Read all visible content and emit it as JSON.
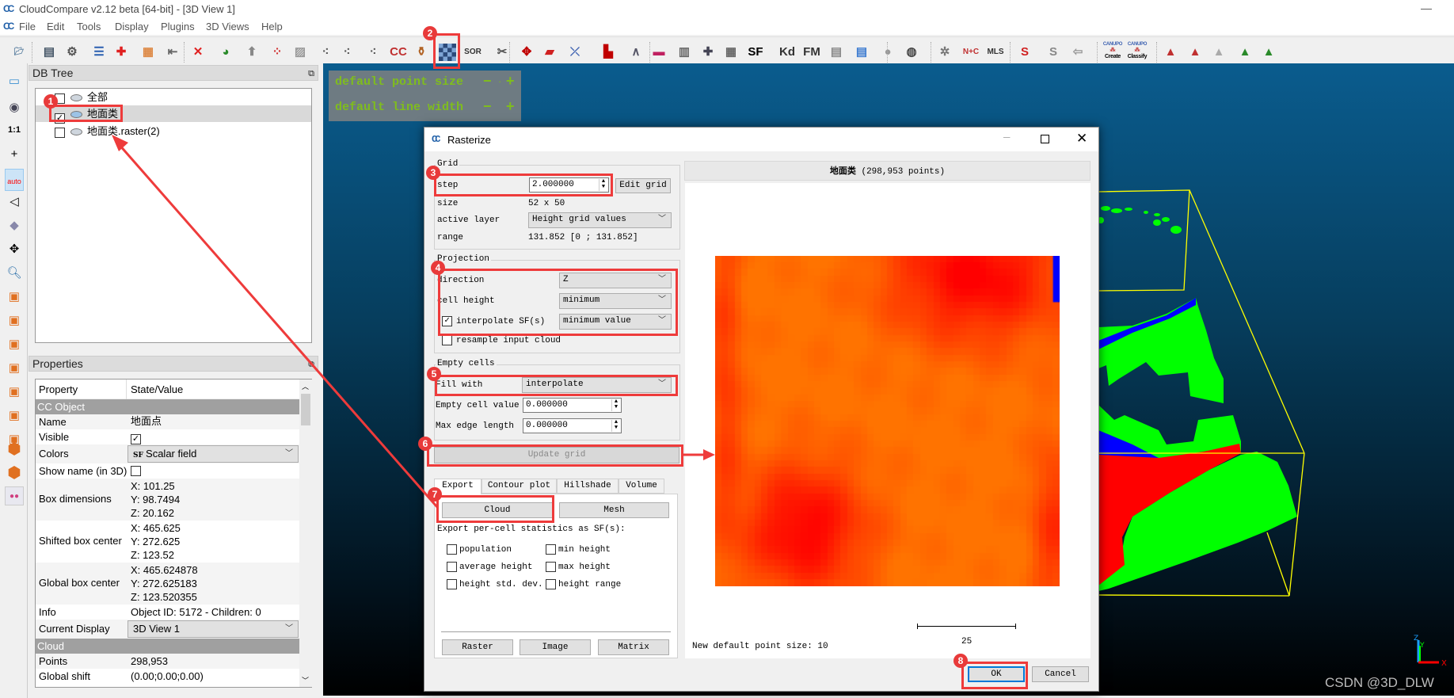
{
  "app": {
    "title": "CloudCompare v2.12 beta [64-bit] - [3D View 1]",
    "logo": "CC"
  },
  "menu": [
    "File",
    "Edit",
    "Tools",
    "Display",
    "Plugins",
    "3D Views",
    "Help"
  ],
  "toolbar": {
    "icons": [
      "open-icon",
      "save-icon",
      "settings-icon",
      "list-icon",
      "clone-icon",
      "color-icon",
      "detach-icon",
      "delete-icon",
      "segment-icon",
      "bust-icon",
      "sample-icon",
      "mesh-icon",
      "points-icon",
      "points2-icon",
      "points3-icon",
      "cc-icon",
      "bottle-icon",
      "rasterize-icon",
      "sor-icon",
      "scissors-icon",
      "translate-icon",
      "plane-icon",
      "cross-icon",
      "histogram-icon",
      "stats-icon",
      "minmax-icon",
      "trash-icon",
      "plus-icon",
      "calculator-icon",
      "sf-icon",
      "kd-icon",
      "fm-icon",
      "shp-icon",
      "csv-icon",
      "sphere-icon",
      "globe-icon",
      "puzzle-icon",
      "normals-icon",
      "mls-icon",
      "curve-icon",
      "trace-icon",
      "export-icon",
      "canupo-create-icon",
      "canupo-classify-icon",
      "rgb-icon",
      "hsv-icon",
      "gray-icon",
      "h-icon",
      "k-icon"
    ],
    "labels": {
      "sor": "SOR",
      "sf": "SF",
      "kd": "Kd",
      "fm": "FM",
      "nc": "N+C",
      "mls": "MLS",
      "canupo": "CANUPO",
      "create": "Create",
      "classify": "Classify"
    }
  },
  "dbtree": {
    "title": "DB Tree",
    "items": [
      {
        "label": "全部",
        "checked": false
      },
      {
        "label": "地面类",
        "checked": true,
        "selected": true
      },
      {
        "label": "地面类.raster(2)",
        "checked": false
      }
    ]
  },
  "properties": {
    "title": "Properties",
    "col_property": "Property",
    "col_value": "State/Value",
    "section_cc": "CC Object",
    "section_cloud": "Cloud",
    "name_k": "Name",
    "name_v": "地面点",
    "visible_k": "Visible",
    "colors_k": "Colors",
    "colors_v": "Scalar field",
    "showname_k": "Show name (in 3D)",
    "box_k": "Box dimensions",
    "box_v": [
      "X: 101.25",
      "Y: 98.7494",
      "Z: 20.162"
    ],
    "shifted_k": "Shifted box center",
    "shifted_v": [
      "X: 465.625",
      "Y: 272.625",
      "Z: 123.52"
    ],
    "global_k": "Global box center",
    "global_v": [
      "X: 465.624878",
      "Y: 272.625183",
      "Z: 123.520355"
    ],
    "info_k": "Info",
    "info_v": "Object ID: 5172 - Children: 0",
    "display_k": "Current Display",
    "display_v": "3D View 1",
    "points_k": "Points",
    "points_v": "298,953",
    "shift_k": "Global shift",
    "shift_v": "(0.00;0.00;0.00)"
  },
  "view3d": {
    "point_size_label": "default point size",
    "line_width_label": "default line width",
    "watermark": "CSDN @3D_DLW",
    "axes": [
      "Z",
      "Y",
      "X"
    ]
  },
  "dialog": {
    "title": "Rasterize",
    "grid": {
      "title": "Grid",
      "step_label": "step",
      "step_value": "2.000000",
      "edit_grid": "Edit grid",
      "size_label": "size",
      "size_value": "52 x 50",
      "layer_label": "active layer",
      "layer_value": "Height grid values",
      "range_label": "range",
      "range_value": "131.852 [0 ; 131.852]"
    },
    "projection": {
      "title": "Projection",
      "direction_label": "direction",
      "direction_value": "Z",
      "cell_label": "cell height",
      "cell_value": "minimum",
      "interp_label": "interpolate SF(s)",
      "interp_checked": true,
      "interp_value": "minimum value",
      "resample_label": "resample input cloud",
      "resample_checked": false
    },
    "empty": {
      "title": "Empty cells",
      "fill_label": "Fill with",
      "fill_value": "interpolate",
      "value_label": "Empty cell value",
      "value_value": "0.000000",
      "edge_label": "Max edge length",
      "edge_value": "0.000000"
    },
    "update_grid": "Update grid",
    "tabs": [
      "Export",
      "Contour plot",
      "Hillshade",
      "Volume"
    ],
    "export": {
      "cloud": "Cloud",
      "mesh": "Mesh",
      "stats_label": "Export per-cell statistics as SF(s):",
      "stats": [
        "population",
        "min height",
        "average height",
        "max height",
        "height std. dev.",
        "height range"
      ],
      "raster": "Raster",
      "image": "Image",
      "matrix": "Matrix"
    },
    "preview": {
      "header_name": "地面类",
      "header_count": "(298,953 points)",
      "scale_value": "25",
      "point_size_msg": "New default point size: 10",
      "grid_cols": 52,
      "grid_rows": 50
    },
    "ok": "OK",
    "cancel": "Cancel"
  },
  "annotations": [
    "1",
    "2",
    "3",
    "4",
    "5",
    "6",
    "7",
    "8"
  ],
  "colors": {
    "annotation": "#e83a3a",
    "overlay_text": "#7fbd1d",
    "bbox": "#ffff00",
    "ground": "#00ff00",
    "red_class": "#ff0000",
    "blue_class": "#0000ff"
  }
}
